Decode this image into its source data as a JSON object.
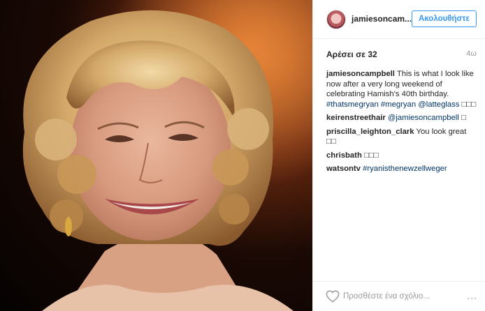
{
  "post": {
    "photo": {
      "alt_subject": "portrait-photo"
    },
    "author": {
      "username": "jamiesoncam...",
      "follow_label": "Ακολουθήστε"
    },
    "likes": {
      "label": "Αρέσει σε",
      "count": "32"
    },
    "age": "4ω",
    "comments": [
      {
        "user": "jamiesoncampbell",
        "text": "This is what I look like now after a very long weekend of celebrating Hamish's 40th birthday.",
        "tags": [
          "#thatsmegryan",
          "#megryan",
          "@latteglass"
        ],
        "emoji": "□□□"
      },
      {
        "user": "keirenstreethair",
        "mention": "@jamiesoncampbell",
        "emoji": "□"
      },
      {
        "user": "priscilla_leighton_clark",
        "text": "You look great",
        "emoji": "□□"
      },
      {
        "user": "chrisbath",
        "emoji": "□□□"
      },
      {
        "user": "watsontv",
        "tags": [
          "#ryanisthenewzellweger"
        ]
      }
    ],
    "footer": {
      "comment_placeholder": "Προσθέστε ένα σχόλιο...",
      "more_label": "..."
    }
  },
  "colors": {
    "accent": "#3897f0",
    "link": "#003569",
    "text": "#262626",
    "muted": "#999999"
  }
}
